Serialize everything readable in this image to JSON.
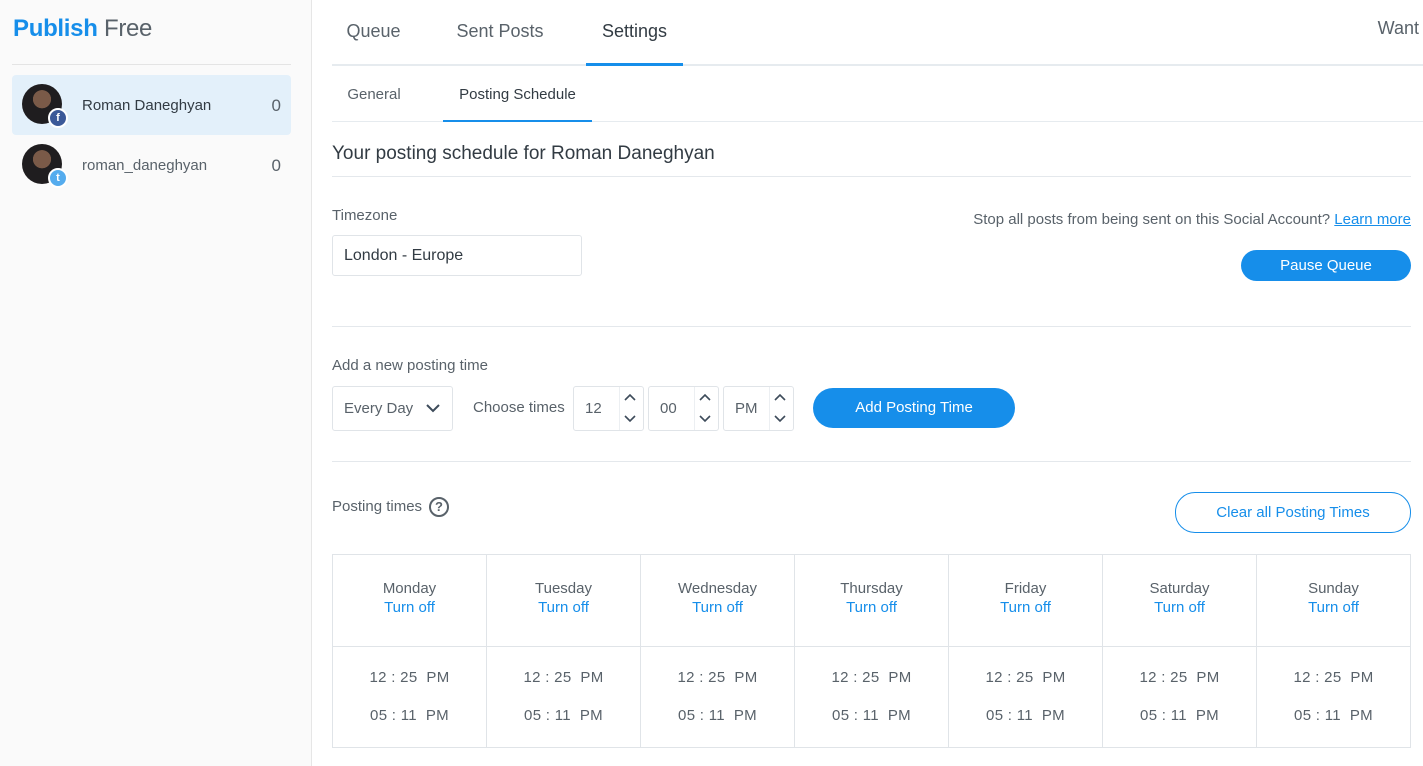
{
  "brand": {
    "part1": "Publish",
    "part2": "Free"
  },
  "accounts": [
    {
      "name": "Roman Daneghyan",
      "count": "0",
      "network": "facebook",
      "network_glyph": "f"
    },
    {
      "name": "roman_daneghyan",
      "count": "0",
      "network": "twitter",
      "network_glyph": "t"
    }
  ],
  "tabs": [
    {
      "label": "Queue"
    },
    {
      "label": "Sent Posts"
    },
    {
      "label": "Settings"
    }
  ],
  "header_right": "Want",
  "subtabs": [
    {
      "label": "General"
    },
    {
      "label": "Posting Schedule"
    }
  ],
  "heading": "Your posting schedule for Roman Daneghyan",
  "timezone": {
    "label": "Timezone",
    "value": "London - Europe"
  },
  "pause": {
    "text": "Stop all posts from being sent on this Social Account?",
    "link": "Learn more",
    "button": "Pause Queue"
  },
  "add_time": {
    "label": "Add a new posting time",
    "day_select": "Every Day",
    "choose_label": "Choose times",
    "hour": "12",
    "minute": "00",
    "ampm": "PM",
    "button": "Add Posting Time"
  },
  "posting_times": {
    "label": "Posting times",
    "help_glyph": "?",
    "clear_button": "Clear all Posting Times",
    "turn_off_label": "Turn off",
    "days": [
      {
        "name": "Monday",
        "times": [
          "12 : 25  PM",
          "05 : 11  PM"
        ]
      },
      {
        "name": "Tuesday",
        "times": [
          "12 : 25  PM",
          "05 : 11  PM"
        ]
      },
      {
        "name": "Wednesday",
        "times": [
          "12 : 25  PM",
          "05 : 11  PM"
        ]
      },
      {
        "name": "Thursday",
        "times": [
          "12 : 25  PM",
          "05 : 11  PM"
        ]
      },
      {
        "name": "Friday",
        "times": [
          "12 : 25  PM",
          "05 : 11  PM"
        ]
      },
      {
        "name": "Saturday",
        "times": [
          "12 : 25  PM",
          "05 : 11  PM"
        ]
      },
      {
        "name": "Sunday",
        "times": [
          "12 : 25  PM",
          "05 : 11  PM"
        ]
      }
    ]
  },
  "colors": {
    "accent": "#168eea",
    "facebook": "#3b5998",
    "twitter": "#55acee",
    "active_bg": "#e3f0fa"
  }
}
